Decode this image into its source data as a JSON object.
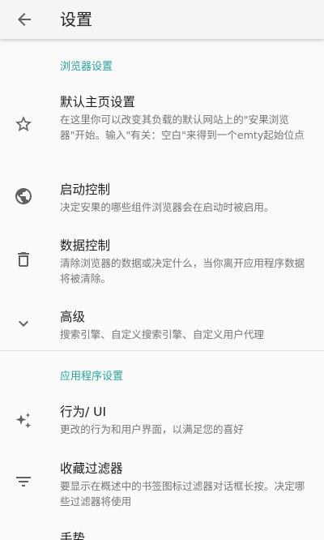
{
  "appbar": {
    "title": "设置",
    "back_icon": "arrow-back-icon"
  },
  "sections": {
    "browser": {
      "header": "浏览器设置",
      "items": [
        {
          "title": "默认主页设置",
          "summary": "在这里你可以改变其负载的默认网站上的\"安果浏览器\"开始。输入\"有关：空白\"来得到一个emty起始位点",
          "icon": "star-outline-icon"
        },
        {
          "title": "启动控制",
          "summary": "决定安果的哪些组件浏览器会在启动时被启用。",
          "icon": "globe-icon"
        },
        {
          "title": "数据控制",
          "summary": "清除浏览器的数据或决定什么，当你离开应用程序数据将被清除。",
          "icon": "trash-icon"
        },
        {
          "title": "高级",
          "summary": "搜索引擎、自定义搜索引擎、自定义用户代理",
          "icon": "chevron-down-icon"
        }
      ]
    },
    "app": {
      "header": "应用程序设置",
      "items": [
        {
          "title": "行为/ UI",
          "summary": "更改的行为和用户界面，以满足您的喜好",
          "icon": "sparkle-icon"
        },
        {
          "title": "收藏过滤器",
          "summary": "要显示在概述中的书签图标过滤器对话框长按。决定哪些过滤器将使用",
          "icon": "filter-icon"
        },
        {
          "title": "手势",
          "summary": "",
          "icon": "gesture-icon"
        }
      ]
    }
  },
  "colors": {
    "accent": "#26a69a",
    "icon": "#616161",
    "title_text": "#212121",
    "summary_text": "#757575"
  }
}
